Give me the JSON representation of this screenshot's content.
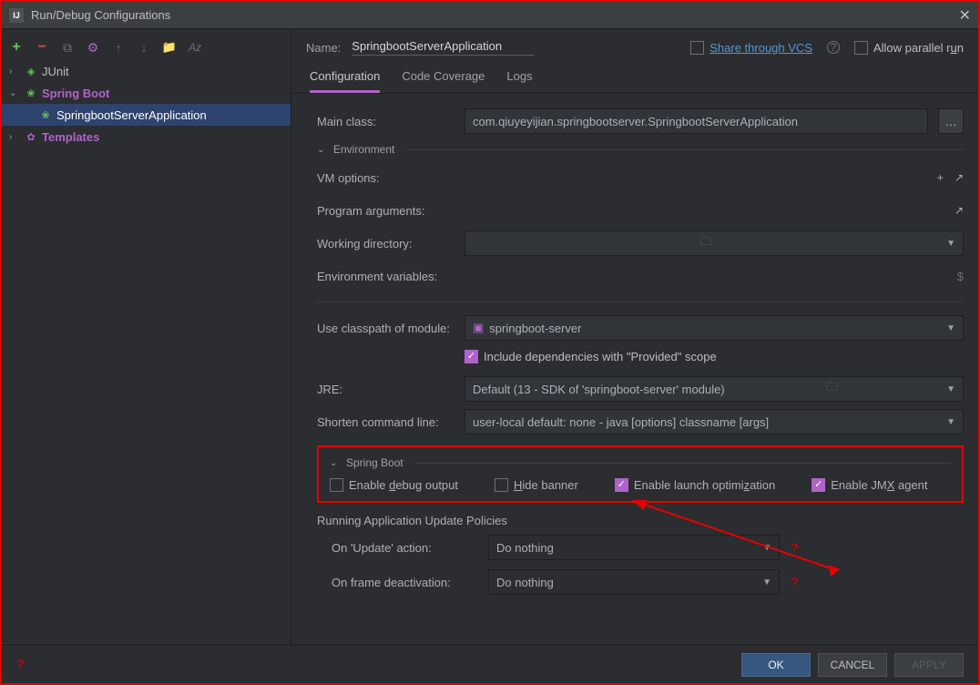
{
  "window": {
    "title": "Run/Debug Configurations"
  },
  "sidebar": {
    "items": [
      {
        "label": "JUnit"
      },
      {
        "label": "Spring Boot"
      },
      {
        "label": "SpringbootServerApplication"
      },
      {
        "label": "Templates"
      }
    ]
  },
  "nameRow": {
    "label": "Name:",
    "value": "SpringbootServerApplication",
    "shareLink": "Share through VCS",
    "allowParallel": "Allow parallel run"
  },
  "tabs": {
    "configuration": "Configuration",
    "coverage": "Code Coverage",
    "logs": "Logs"
  },
  "form": {
    "mainClassLabel": "Main class:",
    "mainClassValue": "com.qiuyeyijian.springbootserver.SpringbootServerApplication",
    "environment": "Environment",
    "vmOptions": "VM options:",
    "programArgs": "Program arguments:",
    "workingDir": "Working directory:",
    "envVars": "Environment variables:",
    "useClasspath": "Use classpath of module:",
    "classpathModule": "springboot-server",
    "includeProvided": "Include dependencies with \"Provided\" scope",
    "jre": "JRE:",
    "jreValue": "Default (13 - SDK of 'springboot-server' module)",
    "shorten": "Shorten command line:",
    "shortenValue": "user-local default: none - java [options] classname [args]"
  },
  "springBox": {
    "header": "Spring Boot",
    "enableDebug": "Enable debug output",
    "hideBanner": "Hide banner",
    "enableLaunch": "Enable launch optimization",
    "enableJmx": "Enable JMX agent"
  },
  "policies": {
    "title": "Running Application Update Policies",
    "onUpdate": "On 'Update' action:",
    "onFrame": "On frame deactivation:",
    "doNothing": "Do nothing"
  },
  "footer": {
    "ok": "OK",
    "cancel": "CANCEL",
    "apply": "APPLY"
  }
}
